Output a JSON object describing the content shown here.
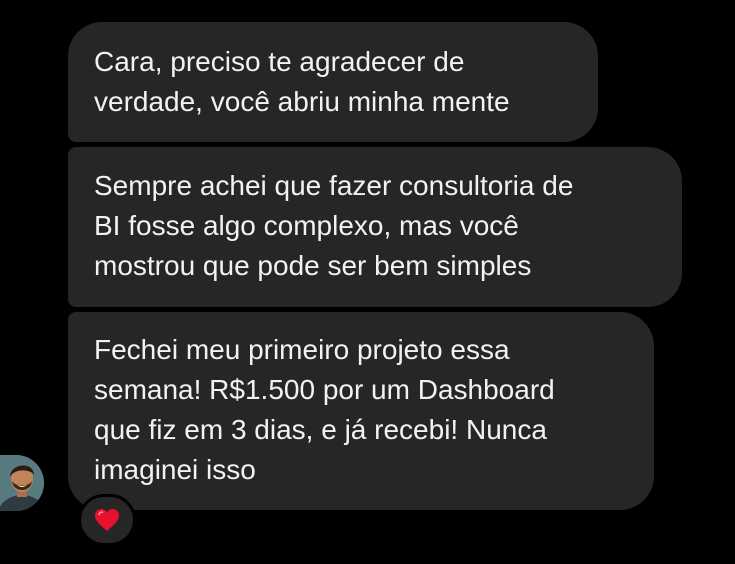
{
  "messages": [
    {
      "text": "Cara, preciso te agradecer de\nverdade, você abriu minha mente"
    },
    {
      "text": "Sempre achei que fazer consultoria de\nBI fosse algo complexo, mas você\nmostrou que pode ser bem simples"
    },
    {
      "text": "Fechei meu primeiro projeto essa\nsemana! R$1.500 por um Dashboard\nque fiz em 3 dias, e já recebi! Nunca\nimaginei isso"
    }
  ],
  "reaction": {
    "icon": "heart-icon",
    "color": "#e8102e"
  },
  "colors": {
    "background": "#000000",
    "bubble": "#262626",
    "text": "#f2f2f2"
  }
}
